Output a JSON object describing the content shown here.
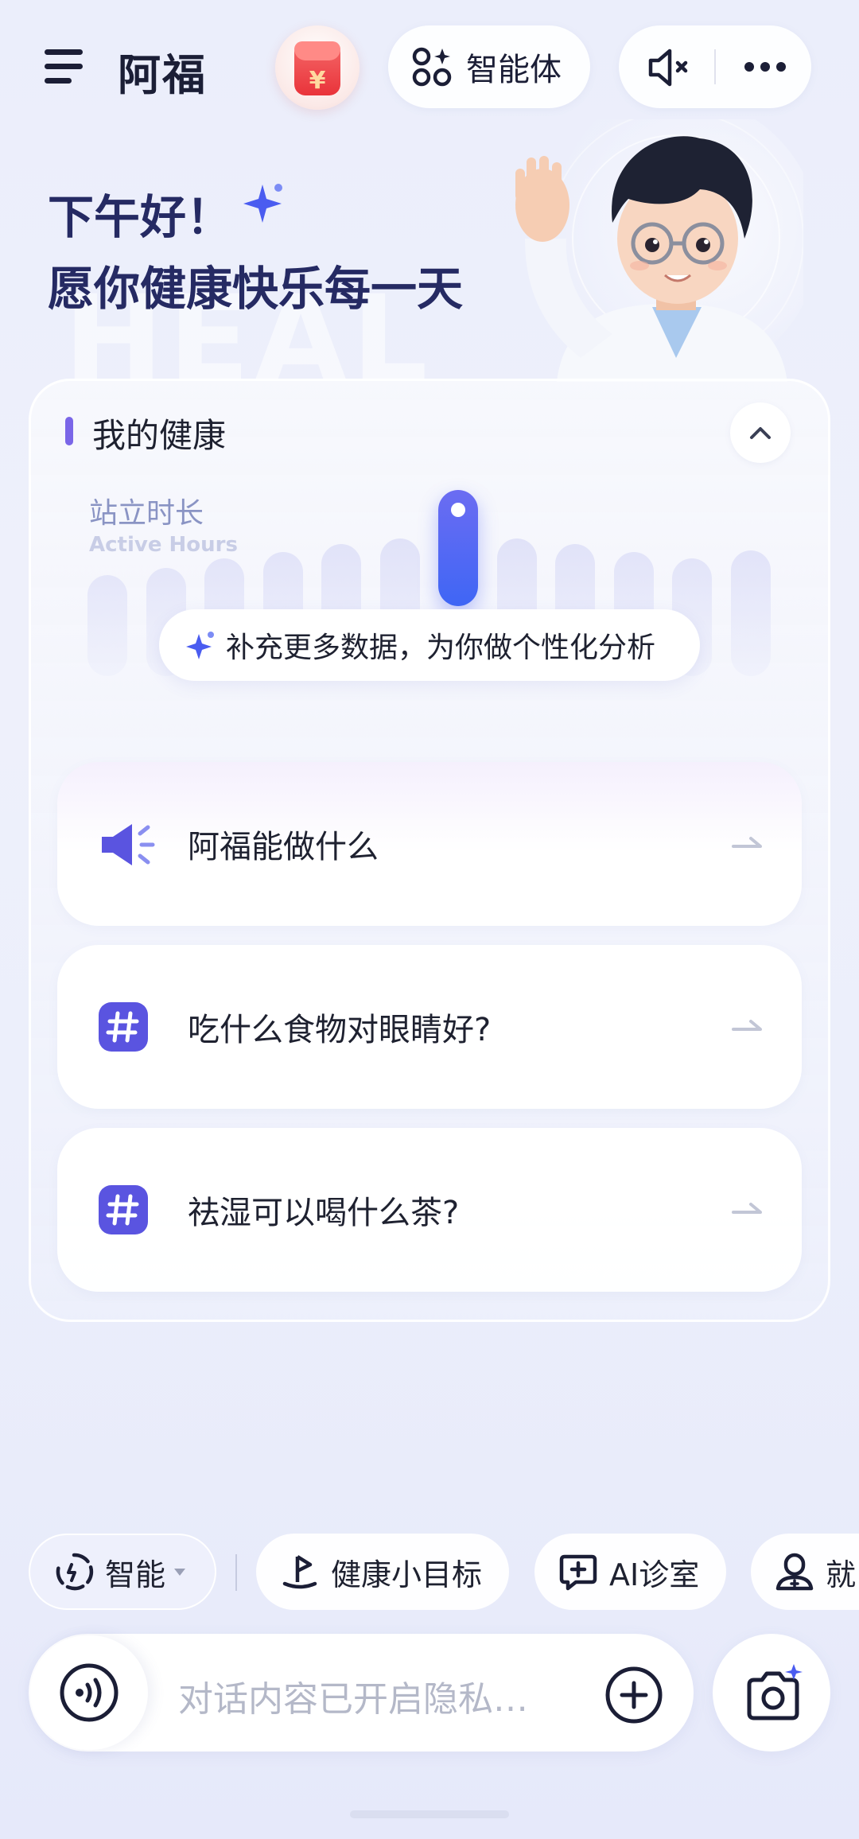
{
  "header": {
    "app_name": "阿福",
    "agent_label": "智能体",
    "icons": [
      "menu-icon",
      "red-packet-icon",
      "agents-grid-icon",
      "mute-speaker-icon",
      "more-dots-icon"
    ]
  },
  "greeting": {
    "line1": "下午好！",
    "line2": "愿你健康快乐每一天",
    "background_word": "HEAL"
  },
  "health_card": {
    "title": "我的健康",
    "metric_label": "站立时长",
    "metric_sublabel": "Active Hours",
    "bars": [
      {
        "level": 0.55,
        "highlight": false
      },
      {
        "level": 0.62,
        "highlight": false
      },
      {
        "level": 0.72,
        "highlight": false
      },
      {
        "level": 0.78,
        "highlight": false
      },
      {
        "level": 0.86,
        "highlight": false
      },
      {
        "level": 0.92,
        "highlight": false
      },
      {
        "level": 1.0,
        "highlight": true
      },
      {
        "level": 0.92,
        "highlight": false
      },
      {
        "level": 0.86,
        "highlight": false
      },
      {
        "level": 0.78,
        "highlight": false
      },
      {
        "level": 0.72,
        "highlight": false
      },
      {
        "level": 0.8,
        "highlight": false
      }
    ],
    "hint": "补充更多数据，为你做个性化分析"
  },
  "suggestions": [
    {
      "text": "阿福能做什么",
      "icon": "megaphone-icon"
    },
    {
      "text": "吃什么食物对眼睛好?",
      "icon": "hashtag-icon"
    },
    {
      "text": "祛湿可以喝什么茶?",
      "icon": "hashtag-icon"
    }
  ],
  "quick_chips": [
    {
      "label": "智能",
      "icon": "smart-mode-icon"
    },
    {
      "label": "健康小目标",
      "icon": "goal-flag-icon"
    },
    {
      "label": "AI诊室",
      "icon": "ai-clinic-icon"
    },
    {
      "label": "就",
      "icon": "doctor-icon"
    }
  ],
  "input": {
    "placeholder": "对话内容已开启隐私…"
  },
  "colors": {
    "accent": "#4a5cf0",
    "accent_purple": "#7a66e8",
    "title_dark": "#252a63",
    "bar_light": "#dde1f6"
  }
}
